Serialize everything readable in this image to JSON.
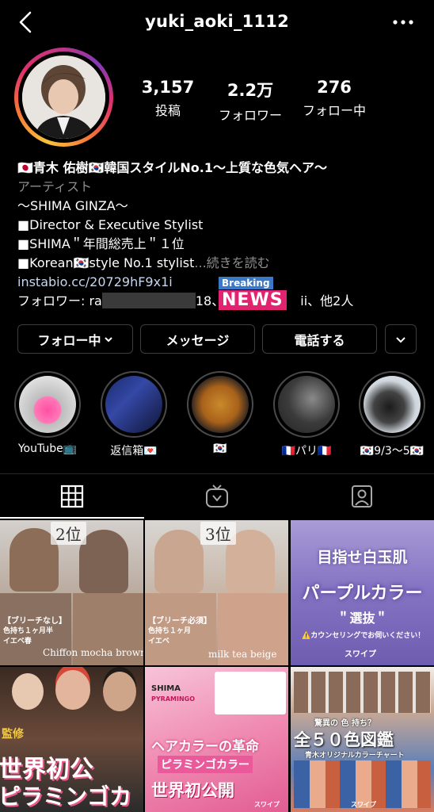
{
  "header": {
    "username": "yuki_aoki_1112",
    "back_icon": "chevron-left-icon",
    "more_icon": "more-horizontal-icon"
  },
  "stats": [
    {
      "value": "3,157",
      "label": "投稿"
    },
    {
      "value": "2.2万",
      "label": "フォロワー"
    },
    {
      "value": "276",
      "label": "フォロー中"
    }
  ],
  "bio": {
    "name": "🇯🇵青木 佑樹🇰🇷韓国スタイルNo.1〜上質な色気ヘア〜",
    "category": "アーティスト",
    "lines": [
      "〜SHIMA GINZA〜",
      "■Director & Executive Stylist",
      "■SHIMA＂年間総売上＂１位",
      "■Korean🇰🇷style No.1 stylist"
    ],
    "more": "...続きを読む",
    "link": "instabio.cc/20729hF9x1i",
    "followers_prefix": "フォロワー: ra",
    "followers_mid": "18、",
    "followers_suffix": "ii、他2人"
  },
  "overlay": {
    "breaking": "Breaking",
    "news": "NEWS"
  },
  "buttons": {
    "follow": "フォロー中",
    "message": "メッセージ",
    "call": "電話する",
    "chevron_icon": "chevron-down-icon"
  },
  "highlights": [
    {
      "label": "YouTube📺"
    },
    {
      "label": "返信箱💌"
    },
    {
      "label": "🇰🇷"
    },
    {
      "label": "🇫🇷パリ🇫🇷"
    },
    {
      "label": "🇰🇷9/3〜5🇰🇷"
    }
  ],
  "tabs": {
    "grid_icon": "grid-icon",
    "igtv_icon": "igtv-icon",
    "tagged_icon": "tagged-user-icon"
  },
  "posts": {
    "p1": {
      "rank": "2位",
      "caption": "Chiffon mocha brown",
      "sub": "【ブリーチなし】",
      "sub2": "色持ち１ヶ月半",
      "sub3": "イエベ春"
    },
    "p2": {
      "rank": "3位",
      "caption": "milk tea beige",
      "sub": "【ブリーチ必須】",
      "sub2": "色持ち１ヶ月",
      "sub3": "イエベ"
    },
    "p3": {
      "title": "目指せ白玉肌",
      "main": "パープルカラー",
      "badge": "＂選抜＂",
      "note": "⚠️カウンセリングでお伺いください！",
      "tag": "スワイプ"
    },
    "p4": {
      "big1": "世界初公",
      "big2": "ピラミンゴカ",
      "side": "監修"
    },
    "p5": {
      "brand": "SHIMA",
      "brand2": "PYRAMINGO",
      "line1": "ヘアカラーの革命",
      "line2": "ピラミンゴカラー",
      "line3": "世界初公開",
      "tag": "スワイプ"
    },
    "p6": {
      "top": "驚異の 色 持ち？",
      "title": "全５０色図鑑",
      "sub": "青木オリジナルカラーチャート",
      "tag": "スワイプ"
    }
  }
}
